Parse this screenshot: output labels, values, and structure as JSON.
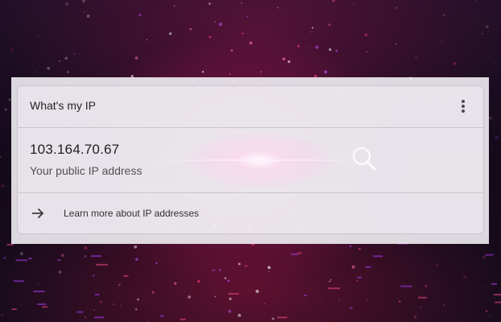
{
  "widget": {
    "title": "What's my IP",
    "menu_icon": "more-vert-icon",
    "ip_address": "103.164.70.67",
    "ip_caption": "Your public IP address",
    "search_icon": "search-icon",
    "learn_more_icon": "arrow-right-icon",
    "learn_more_label": "Learn more about IP addresses"
  },
  "colors": {
    "card_background": "#ece8ee",
    "card_border": "#cbc6cd",
    "text_primary": "#262427",
    "text_secondary": "#525055",
    "backdrop_glow": "#ff78c8",
    "backdrop_dark": "#150a18"
  }
}
